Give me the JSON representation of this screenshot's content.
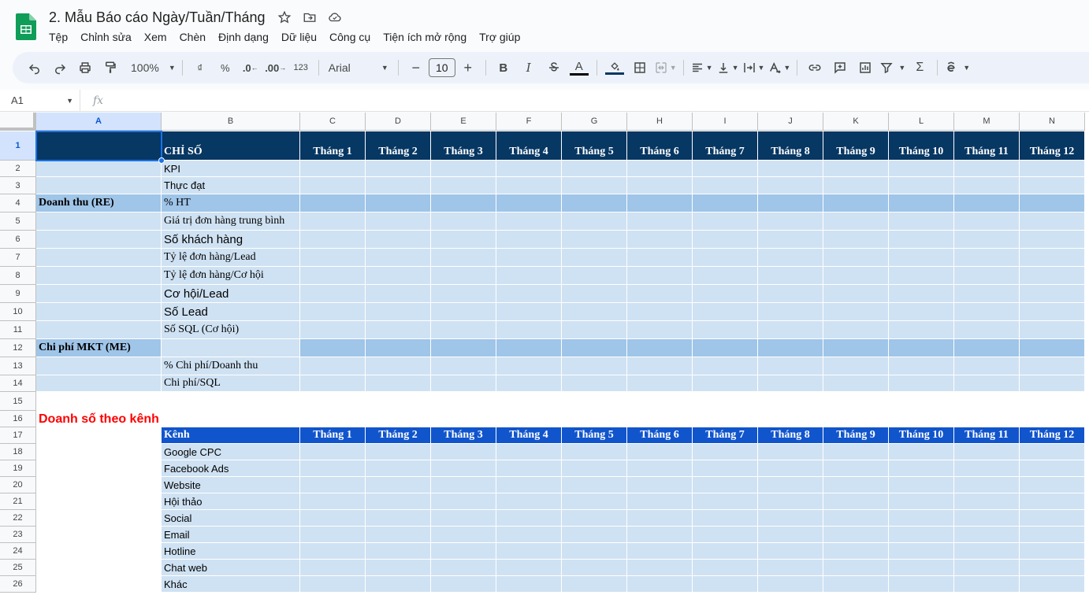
{
  "app": {
    "doc_title": "2. Mẫu Báo cáo Ngày/Tuần/Tháng",
    "menu": [
      "Tệp",
      "Chỉnh sửa",
      "Xem",
      "Chèn",
      "Định dạng",
      "Dữ liệu",
      "Công cụ",
      "Tiện ích mở rộng",
      "Trợ giúp"
    ]
  },
  "toolbar": {
    "zoom": "100%",
    "currency": "₫",
    "percent": "%",
    "dec_less": ".0",
    "dec_more": ".00",
    "format_123": "123",
    "font": "Arial",
    "font_size": "10",
    "minus": "−",
    "plus": "+",
    "bold": "B",
    "italic": "I",
    "text_color": "A",
    "sigma": "Σ"
  },
  "formula_bar": {
    "cell_ref": "A1",
    "fx": "fx",
    "value": ""
  },
  "colors": {
    "header_dark": "#073763",
    "header_blue": "#1155cc",
    "light_blue": "#cfe2f3",
    "mid_blue": "#9fc5e8",
    "section_red": "#ff0000"
  },
  "columns": [
    "A",
    "B",
    "C",
    "D",
    "E",
    "F",
    "G",
    "H",
    "I",
    "J",
    "K",
    "L",
    "M",
    "N"
  ],
  "months": [
    "Tháng 1",
    "Tháng 2",
    "Tháng 3",
    "Tháng 4",
    "Tháng 5",
    "Tháng 6",
    "Tháng 7",
    "Tháng 8",
    "Tháng 9",
    "Tháng 10",
    "Tháng 11",
    "Tháng 12"
  ],
  "sheet": {
    "header_label": "CHỈ SỐ",
    "group_revenue": "Doanh thu (RE)",
    "group_cost": "Chi phí MKT (ME)",
    "metrics_revenue": [
      "KPI",
      "Thực đạt",
      "% HT",
      "Giá trị đơn hàng trung bình",
      "Số khách hàng",
      "Tỷ lệ đơn hàng/Lead",
      "Tỷ lệ đơn hàng/Cơ hội",
      "Cơ hội/Lead",
      "Số Lead",
      "Số SQL (Cơ hội)"
    ],
    "metrics_cost": [
      "% Chi phí/Doanh thu",
      "Chi phí/SQL"
    ],
    "section_title": "Doanh số theo kênh",
    "channel_header": "Kênh",
    "channels": [
      "Google CPC",
      "Facebook Ads",
      "Website",
      "Hội thảo",
      "Social",
      "Email",
      "Hotline",
      "Chat web",
      "Khác"
    ]
  }
}
